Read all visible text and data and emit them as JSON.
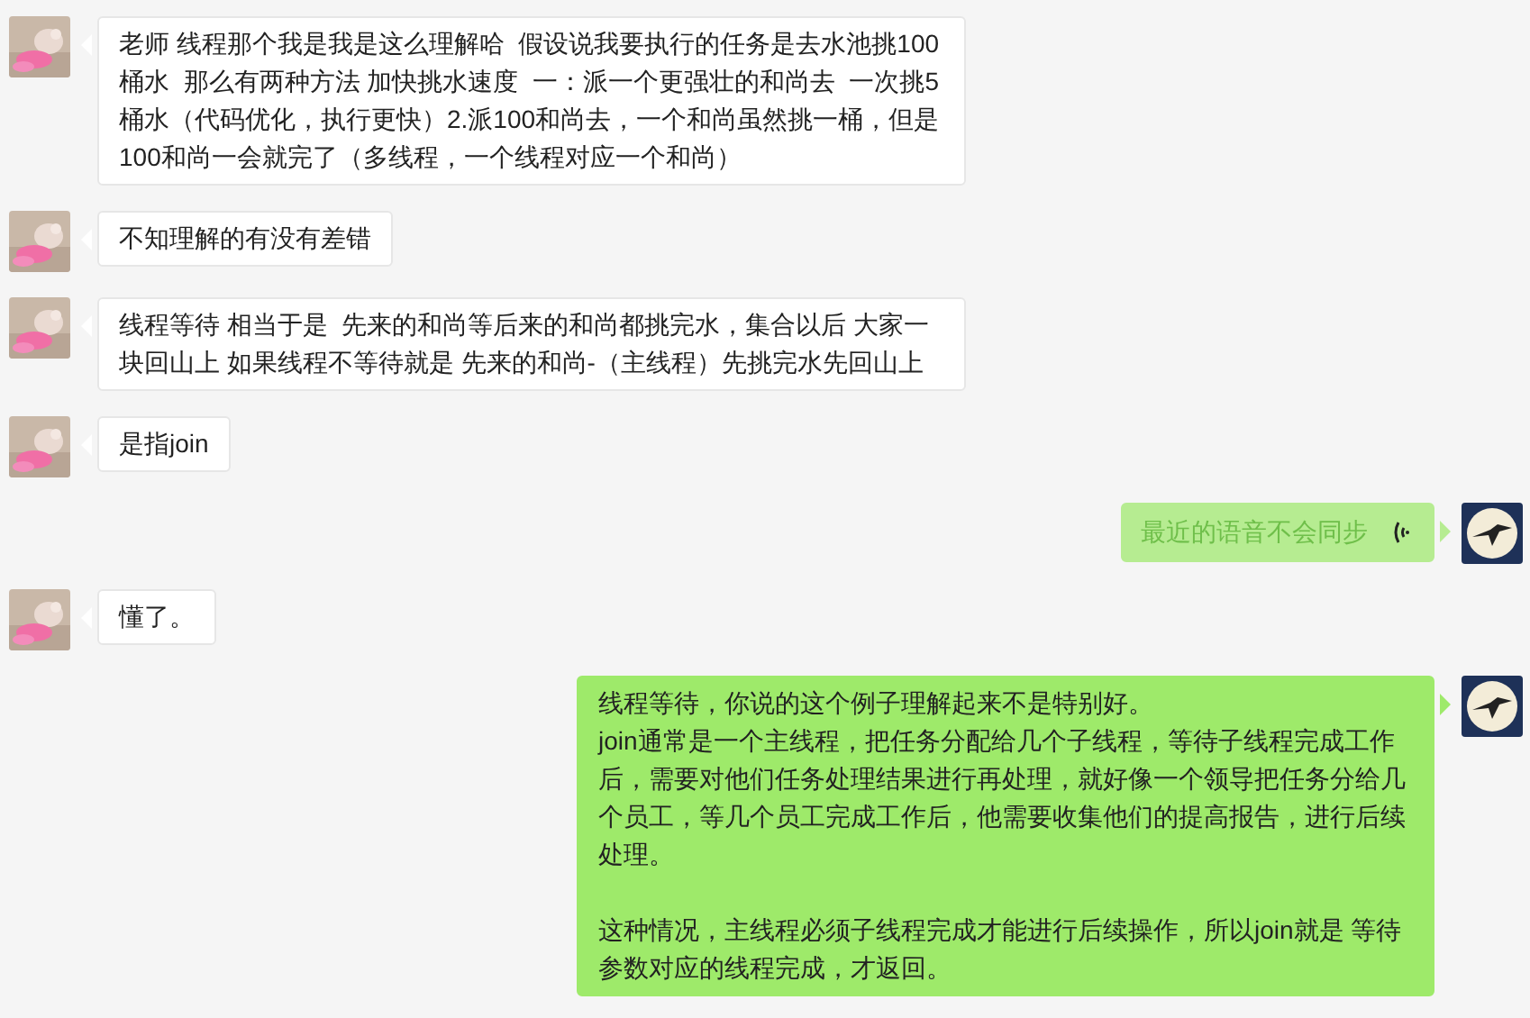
{
  "messages": [
    {
      "kind": "received-text",
      "paragraphs": [
        [
          "老师 线程那个我是我是这么理解哈  假设说我要执行的任务是去水池挑100桶水  那么有两种方法 加快挑水速度  一：派一个更强壮的和尚去  一次挑5桶水（代码优化，执行更快）2.派100和尚去，一个和尚虽然挑一桶，但是100和尚一会就完了（多线程，一个线程对应一个和尚）"
        ]
      ]
    },
    {
      "kind": "received-text",
      "paragraphs": [
        [
          "不知理解的有没有差错"
        ]
      ]
    },
    {
      "kind": "received-text",
      "paragraphs": [
        [
          "线程等待 相当于是  先来的和尚等后来的和尚都挑完水，集合以后 大家一块回山上 如果线程不等待就是 先来的和尚-（主线程）先挑完水先回山上"
        ]
      ]
    },
    {
      "kind": "received-text",
      "paragraphs": [
        [
          "是指join"
        ]
      ]
    },
    {
      "kind": "sent-voice",
      "paragraphs": [
        [
          "最近的语音不会同步"
        ]
      ]
    },
    {
      "kind": "received-text",
      "paragraphs": [
        [
          "懂了。"
        ]
      ]
    },
    {
      "kind": "sent-text",
      "paragraphs": [
        [
          "线程等待，你说的这个例子理解起来不是特别好。",
          "join通常是一个主线程，把任务分配给几个子线程，等待子线程完成工作后，需要对他们任务处理结果进行再处理，就好像一个领导把任务分给几个员工，等几个员工完成工作后，他需要收集他们的提高报告，进行后续处理。"
        ],
        [
          "这种情况，主线程必须子线程完成才能进行后续操作，所以join就是 等待参数对应的线程完成，才返回。"
        ]
      ]
    }
  ]
}
